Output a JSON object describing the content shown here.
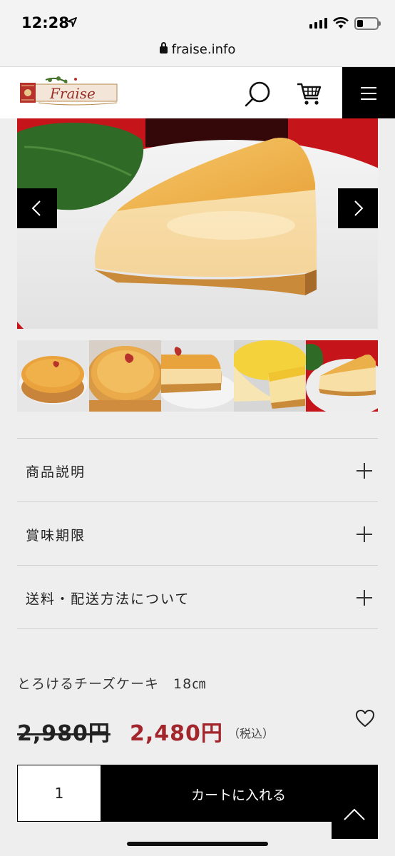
{
  "status_bar": {
    "time": "12:28"
  },
  "browser": {
    "url": "fraise.info"
  },
  "header": {
    "logo_text": "Fraise"
  },
  "gallery": {
    "thumbnail_count": 5,
    "prev_label": "‹",
    "next_label": "›"
  },
  "accordion": {
    "items": [
      {
        "label": "商品説明"
      },
      {
        "label": "賞味期限"
      },
      {
        "label": "送料・配送方法について"
      }
    ]
  },
  "product": {
    "name": "とろけるチーズケーキ　18㎝",
    "price_original": "2,980円",
    "price_sale": "2,480円",
    "tax_note": "（税込）"
  },
  "cart": {
    "quantity": "1",
    "add_label": "カートに入れる"
  },
  "colors": {
    "accent": "#a3262c",
    "header_black": "#000000",
    "page_bg": "#eeeeee"
  }
}
